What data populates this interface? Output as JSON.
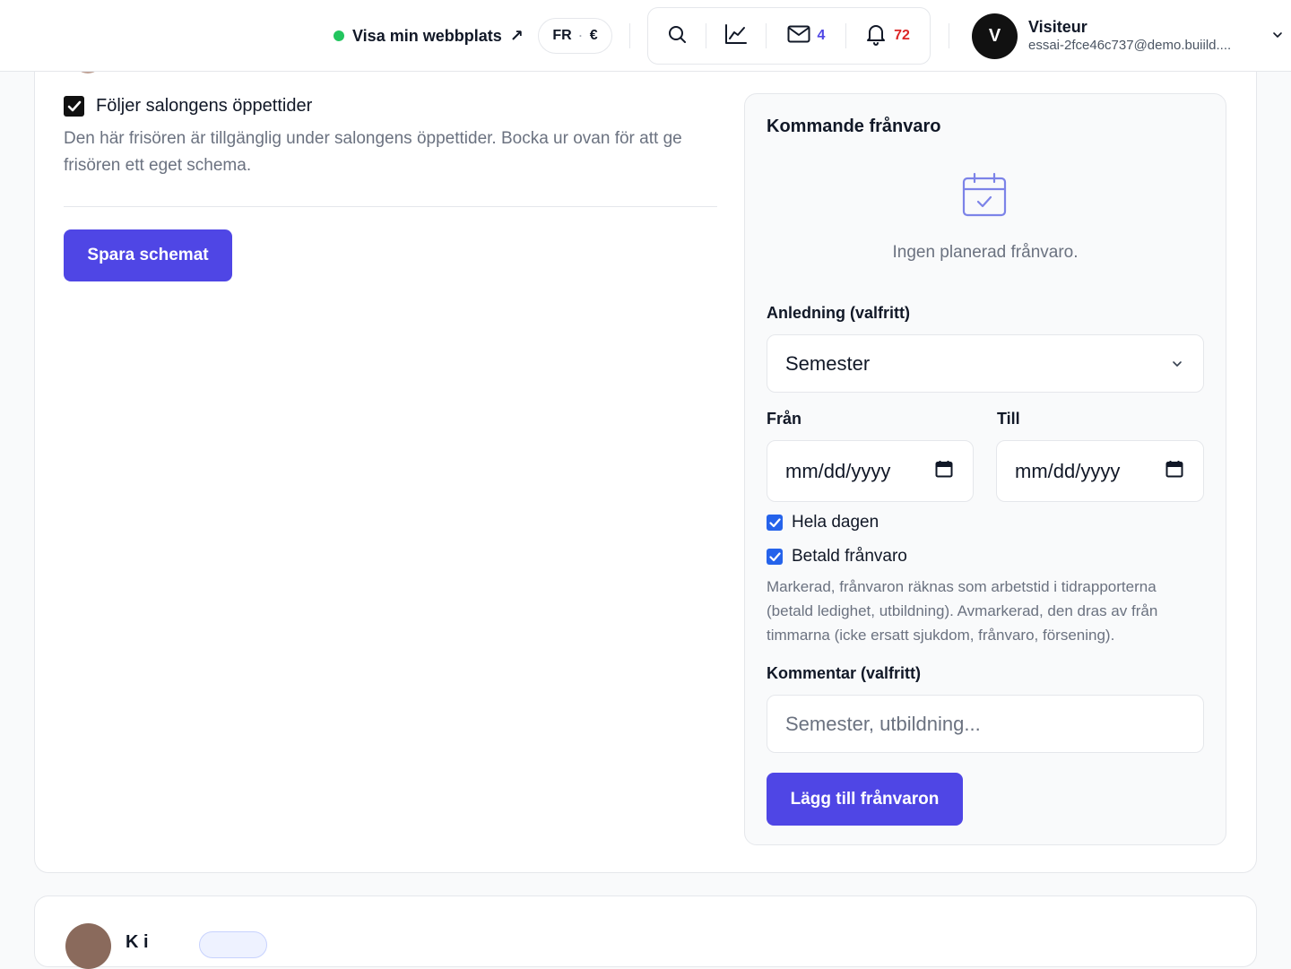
{
  "topbar": {
    "visit_site_label": "Visa min webbplats",
    "visit_site_arrow": "↗",
    "lang_code": "FR",
    "lang_sep": "·",
    "currency": "€",
    "messages_count": "4",
    "notifications_count": "72",
    "user": {
      "initial": "V",
      "name": "Visiteur",
      "email": "essai-2fce46c737@demo.buiild...."
    }
  },
  "schedule": {
    "follow_label": "Följer salongens öppettider",
    "follow_description": "Den här frisören är tillgänglig under salongens öppettider. Bocka ur ovan för att ge frisören ett eget schema.",
    "save_button": "Spara schemat"
  },
  "absence": {
    "title": "Kommande frånvaro",
    "empty_text": "Ingen planerad frånvaro.",
    "reason_label": "Anledning (valfritt)",
    "reason_value": "Semester",
    "from_label": "Från",
    "to_label": "Till",
    "from_value": "mm/dd/yyyy",
    "to_value": "mm/dd/yyyy",
    "all_day_label": "Hela dagen",
    "paid_label": "Betald frånvaro",
    "paid_help": "Markerad, frånvaron räknas som arbetstid i tidrapporterna (betald ledighet, utbildning). Avmarkerad, den dras av från timmarna (icke ersatt sjukdom, frånvaro, försening).",
    "comment_label": "Kommentar (valfritt)",
    "comment_placeholder": "Semester, utbildning...",
    "add_button": "Lägg till frånvaron"
  },
  "next_card": {
    "name_partial": "K   i"
  },
  "colors": {
    "accent": "#4f46e5",
    "checkbox_blue": "#2563eb",
    "online_green": "#22c55e",
    "notification_red": "#dc2626"
  }
}
